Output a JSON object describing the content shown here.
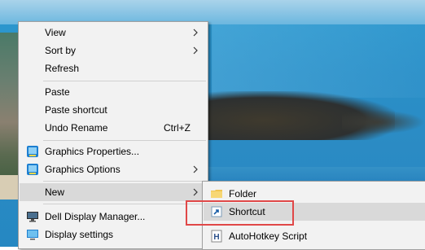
{
  "context_menu": {
    "items": [
      {
        "label": "View",
        "submenu": true
      },
      {
        "label": "Sort by",
        "submenu": true
      },
      {
        "label": "Refresh"
      },
      {
        "label": "Paste"
      },
      {
        "label": "Paste shortcut"
      },
      {
        "label": "Undo Rename",
        "shortcut": "Ctrl+Z"
      },
      {
        "label": "Graphics Properties...",
        "icon": "intel-graphics-icon"
      },
      {
        "label": "Graphics Options",
        "icon": "intel-graphics-icon",
        "submenu": true
      },
      {
        "label": "New",
        "submenu": true,
        "highlighted": true
      },
      {
        "label": "Dell Display Manager...",
        "icon": "monitor-icon"
      },
      {
        "label": "Display settings",
        "icon": "display-icon"
      }
    ]
  },
  "new_submenu": {
    "items": [
      {
        "label": "Folder",
        "icon": "folder-icon"
      },
      {
        "label": "Shortcut",
        "icon": "shortcut-icon",
        "highlighted": true
      },
      {
        "label": "AutoHotkey Script",
        "icon": "ahk-icon"
      }
    ]
  },
  "colors": {
    "menu_bg": "#f2f2f2",
    "hover_bg": "#d9d9d9",
    "callout_red": "#e04848"
  }
}
